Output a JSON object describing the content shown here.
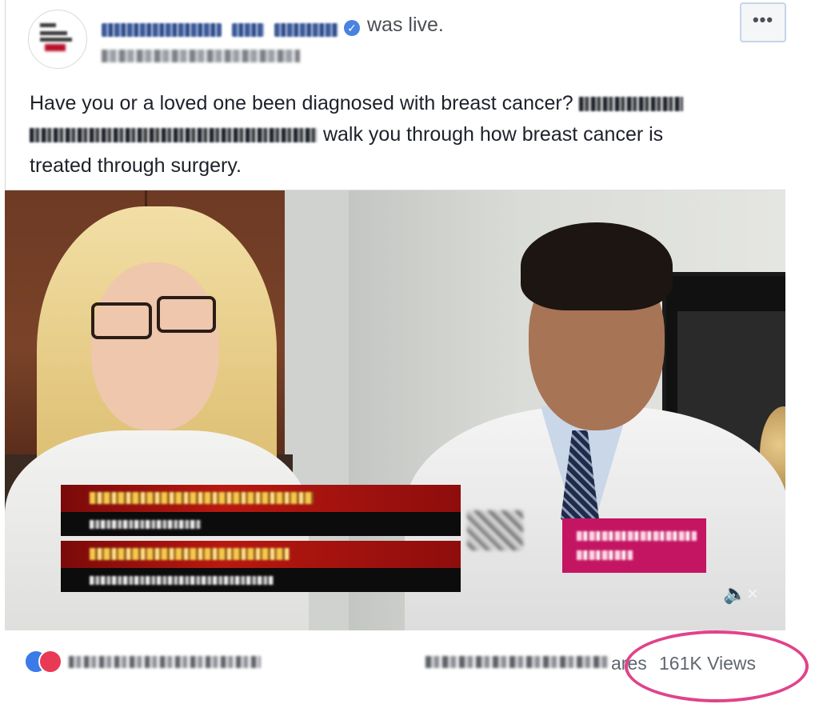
{
  "post": {
    "page_name": "Keck Medicine of USC",
    "status": "was live.",
    "date": "November 20, 2017",
    "more_label": "•••",
    "text_before": "Have you or a loved one been diagnosed with breast cancer?",
    "text_middle": "walk you through how breast cancer is",
    "text_end": "treated through surgery."
  },
  "video": {
    "lower_third_1_name": "Maria B. Rotman, MD",
    "lower_third_1_title": "Breast surgeon",
    "lower_third_2_name": "Kevin M. Patel, MD",
    "lower_third_2_title": "Plastic reconstructive surgery",
    "brand_tag": "Keck Medicine of USC",
    "mute_icon_label": "🔈×"
  },
  "footer": {
    "shares_label": "ares",
    "views_label": "161K Views"
  },
  "colors": {
    "link_blue": "#3b5998",
    "highlight_pink": "#e0438a",
    "brand_red": "#b8122b"
  }
}
